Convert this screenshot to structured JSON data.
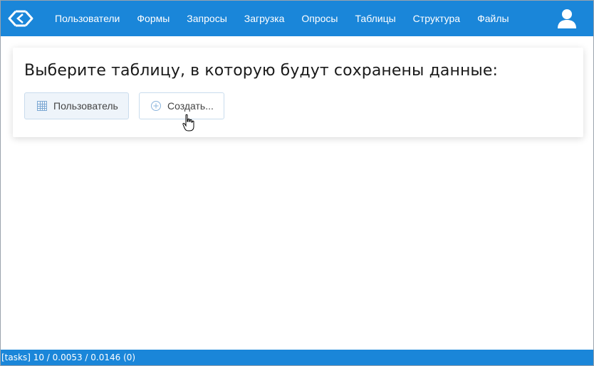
{
  "app": {
    "logo_icon": "brackets-logo-icon"
  },
  "navbar": {
    "items": [
      {
        "label": "Пользователи"
      },
      {
        "label": "Формы"
      },
      {
        "label": "Запросы"
      },
      {
        "label": "Загрузка"
      },
      {
        "label": "Опросы"
      },
      {
        "label": "Таблицы"
      },
      {
        "label": "Структура"
      },
      {
        "label": "Файлы"
      }
    ],
    "user_icon": "user-icon"
  },
  "card": {
    "title": "Выберите таблицу, в которую будут сохранены данные:",
    "buttons": {
      "table_label": "Пользователь",
      "table_icon": "grid-icon",
      "create_label": "Создать...",
      "create_icon": "plus-circle-icon"
    }
  },
  "statusbar": {
    "text": "[tasks] 10 / 0.0053 / 0.0146 (0)"
  },
  "colors": {
    "accent": "#1a86d9",
    "background": "#ffffff"
  }
}
